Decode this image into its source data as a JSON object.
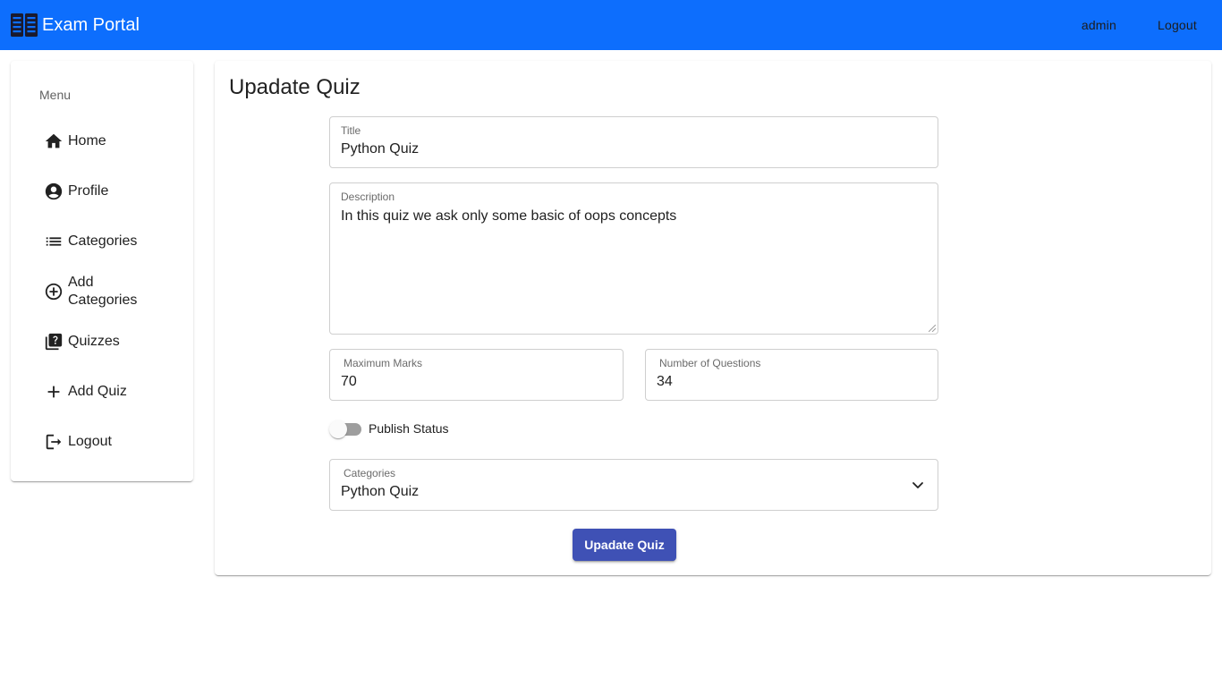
{
  "header": {
    "brand_icon": "book-icon",
    "brand_name": "Exam Portal",
    "user_link": "admin",
    "logout_link": "Logout"
  },
  "sidebar": {
    "title": "Menu",
    "items": [
      {
        "label": "Home",
        "icon": "home-icon"
      },
      {
        "label": "Profile",
        "icon": "account-circle-icon"
      },
      {
        "label": "Categories",
        "icon": "list-icon"
      },
      {
        "label": "Add Categories",
        "icon": "add-circle-icon"
      },
      {
        "label": "Quizzes",
        "icon": "quiz-icon"
      },
      {
        "label": "Add Quiz",
        "icon": "plus-icon"
      },
      {
        "label": "Logout",
        "icon": "logout-icon"
      }
    ]
  },
  "form": {
    "heading": "Upadate Quiz",
    "title": {
      "label": "Title",
      "value": "Python Quiz"
    },
    "description": {
      "label": "Description",
      "value": "In this quiz we ask only some basic of oops concepts"
    },
    "max_marks": {
      "label": "Maximum Marks",
      "value": "70"
    },
    "num_questions": {
      "label": "Number of Questions",
      "value": "34"
    },
    "publish": {
      "label": "Publish Status",
      "checked": false
    },
    "category": {
      "label": "Categories",
      "value": "Python Quiz"
    },
    "submit_label": "Upadate Quiz"
  },
  "colors": {
    "topbar": "#0d6efd",
    "primary_button": "#3f51b5"
  }
}
